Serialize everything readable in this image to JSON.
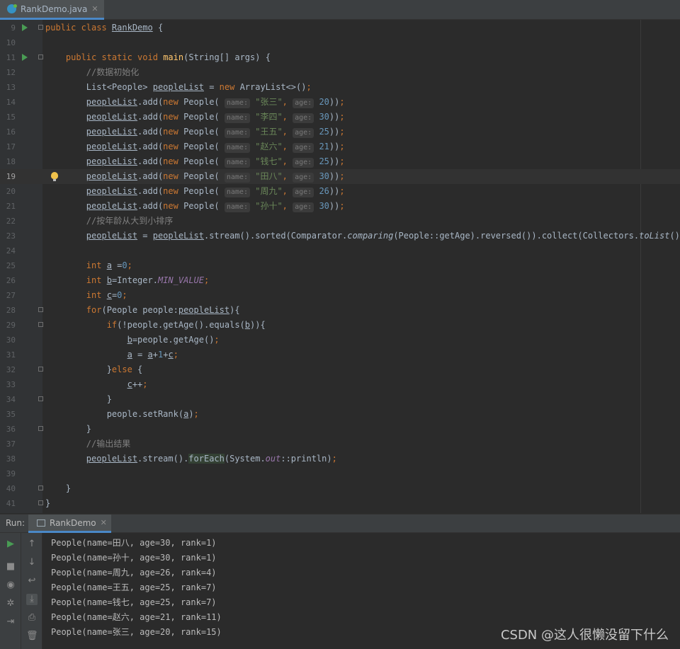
{
  "editor_tab": {
    "label": "RankDemo.java",
    "close": "✕"
  },
  "code_lines": [
    {
      "n": "9",
      "html": "<span class=\"kw\">public class </span><span class=\"ul\">RankDemo</span> {"
    },
    {
      "n": "10",
      "html": ""
    },
    {
      "n": "11",
      "html": "    <span class=\"kw\">public static void </span><span class=\"fn\">main</span>(String[] args) {"
    },
    {
      "n": "12",
      "html": "        <span class=\"cmt\">//数据初始化</span>"
    },
    {
      "n": "13",
      "html": "        List&lt;People&gt; <span class=\"ul\">peopleList</span> = <span class=\"kw\">new </span>ArrayList&lt;&gt;()<span class=\"kw\">;</span>"
    },
    {
      "n": "14",
      "html": "        <span class=\"ul\">peopleList</span>.add(<span class=\"kw\">new </span>People( <span class=\"hint\">name:</span> <span class=\"str\">\"张三\"</span><span class=\"kw\">, </span><span class=\"hint\">age:</span> <span class=\"num\">20</span>))<span class=\"kw\">;</span>"
    },
    {
      "n": "15",
      "html": "        <span class=\"ul\">peopleList</span>.add(<span class=\"kw\">new </span>People( <span class=\"hint\">name:</span> <span class=\"str\">\"李四\"</span><span class=\"kw\">, </span><span class=\"hint\">age:</span> <span class=\"num\">30</span>))<span class=\"kw\">;</span>"
    },
    {
      "n": "16",
      "html": "        <span class=\"ul\">peopleList</span>.add(<span class=\"kw\">new </span>People( <span class=\"hint\">name:</span> <span class=\"str\">\"王五\"</span><span class=\"kw\">, </span><span class=\"hint\">age:</span> <span class=\"num\">25</span>))<span class=\"kw\">;</span>"
    },
    {
      "n": "17",
      "html": "        <span class=\"ul\">peopleList</span>.add(<span class=\"kw\">new </span>People( <span class=\"hint\">name:</span> <span class=\"str\">\"赵六\"</span><span class=\"kw\">, </span><span class=\"hint\">age:</span> <span class=\"num\">21</span>))<span class=\"kw\">;</span>"
    },
    {
      "n": "18",
      "html": "        <span class=\"ul\">peopleList</span>.add(<span class=\"kw\">new </span>People( <span class=\"hint\">name:</span> <span class=\"str\">\"钱七\"</span><span class=\"kw\">, </span><span class=\"hint\">age:</span> <span class=\"num\">25</span>))<span class=\"kw\">;</span>"
    },
    {
      "n": "19",
      "html": "        <span class=\"ul\">peopleList</span>.add(<span class=\"kw\">new </span>People( <span class=\"hint\">name:</span> <span class=\"str\">\"田八\"</span><span class=\"kw\">, </span><span class=\"hint\">age:</span> <span class=\"num\">30</span>))<span class=\"kw\">;</span>"
    },
    {
      "n": "20",
      "html": "        <span class=\"ul\">peopleList</span>.add(<span class=\"kw\">new </span>People( <span class=\"hint\">name:</span> <span class=\"str\">\"周九\"</span><span class=\"kw\">, </span><span class=\"hint\">age:</span> <span class=\"num\">26</span>))<span class=\"kw\">;</span>"
    },
    {
      "n": "21",
      "html": "        <span class=\"ul\">peopleList</span>.add(<span class=\"kw\">new </span>People( <span class=\"hint\">name:</span> <span class=\"str\">\"孙十\"</span><span class=\"kw\">, </span><span class=\"hint\">age:</span> <span class=\"num\">30</span>))<span class=\"kw\">;</span>"
    },
    {
      "n": "22",
      "html": "        <span class=\"cmt\">//按年龄从大到小排序</span>"
    },
    {
      "n": "23",
      "html": "        <span class=\"ul\">peopleList</span> = <span class=\"ul\">peopleList</span>.stream().sorted(Comparator.<span class=\"it\">comparing</span>(People::getAge).reversed()).collect(Collectors.<span class=\"it\">toList</span>())<span class=\"kw\">;</span>"
    },
    {
      "n": "24",
      "html": ""
    },
    {
      "n": "25",
      "html": "        <span class=\"kw\">int </span><span class=\"ul\">a</span> =<span class=\"num\">0</span><span class=\"kw\">;</span>"
    },
    {
      "n": "26",
      "html": "        <span class=\"kw\">int </span><span class=\"ul\">b</span>=Integer.<span class=\"cst\">MIN_VALUE</span><span class=\"kw\">;</span>"
    },
    {
      "n": "27",
      "html": "        <span class=\"kw\">int </span><span class=\"ul\">c</span>=<span class=\"num\">0</span><span class=\"kw\">;</span>"
    },
    {
      "n": "28",
      "html": "        <span class=\"kw\">for</span>(People people:<span class=\"ul\">peopleList</span>){"
    },
    {
      "n": "29",
      "html": "            <span class=\"kw\">if</span>(!people.getAge().equals(<span class=\"ul\">b</span>)){"
    },
    {
      "n": "30",
      "html": "                <span class=\"ul\">b</span>=people.getAge()<span class=\"kw\">;</span>"
    },
    {
      "n": "31",
      "html": "                <span class=\"ul\">a</span> = <span class=\"ul\">a</span>+<span class=\"num\">1</span>+<span class=\"ul\">c</span><span class=\"kw\">;</span>"
    },
    {
      "n": "32",
      "html": "            }<span class=\"kw\">else </span>{"
    },
    {
      "n": "33",
      "html": "                <span class=\"ul\">c</span>++<span class=\"kw\">;</span>"
    },
    {
      "n": "34",
      "html": "            }"
    },
    {
      "n": "35",
      "html": "            people.setRank(<span class=\"ul\">a</span>)<span class=\"kw\">;</span>"
    },
    {
      "n": "36",
      "html": "        }"
    },
    {
      "n": "37",
      "html": "        <span class=\"cmt\">//输出结果</span>"
    },
    {
      "n": "38",
      "html": "        <span class=\"ul\">peopleList</span>.stream().<span class=\"hl\">forEach</span>(System.<span class=\"cst\">out</span>::println)<span class=\"kw\">;</span>"
    },
    {
      "n": "39",
      "html": ""
    },
    {
      "n": "40",
      "html": "    }"
    },
    {
      "n": "41",
      "html": "}"
    }
  ],
  "run_panel": {
    "title": "Run:",
    "tab_label": "RankDemo",
    "tab_close": "✕",
    "output": [
      "People(name=田八, age=30, rank=1)",
      "People(name=孙十, age=30, rank=1)",
      "People(name=周九, age=26, rank=4)",
      "People(name=王五, age=25, rank=7)",
      "People(name=钱七, age=25, rank=7)",
      "People(name=赵六, age=21, rank=11)",
      "People(name=张三, age=20, rank=15)"
    ]
  },
  "toolbar_left_icons": [
    "run-icon",
    "stop-icon",
    "camera-icon",
    "settings-icon",
    "exit-icon"
  ],
  "toolbar_right_icons": [
    "up-arrow-icon",
    "down-arrow-icon",
    "soft-wrap-icon",
    "scroll-to-end-icon",
    "print-icon",
    "trash-icon"
  ],
  "watermark": "CSDN @这人很懒没留下什么"
}
